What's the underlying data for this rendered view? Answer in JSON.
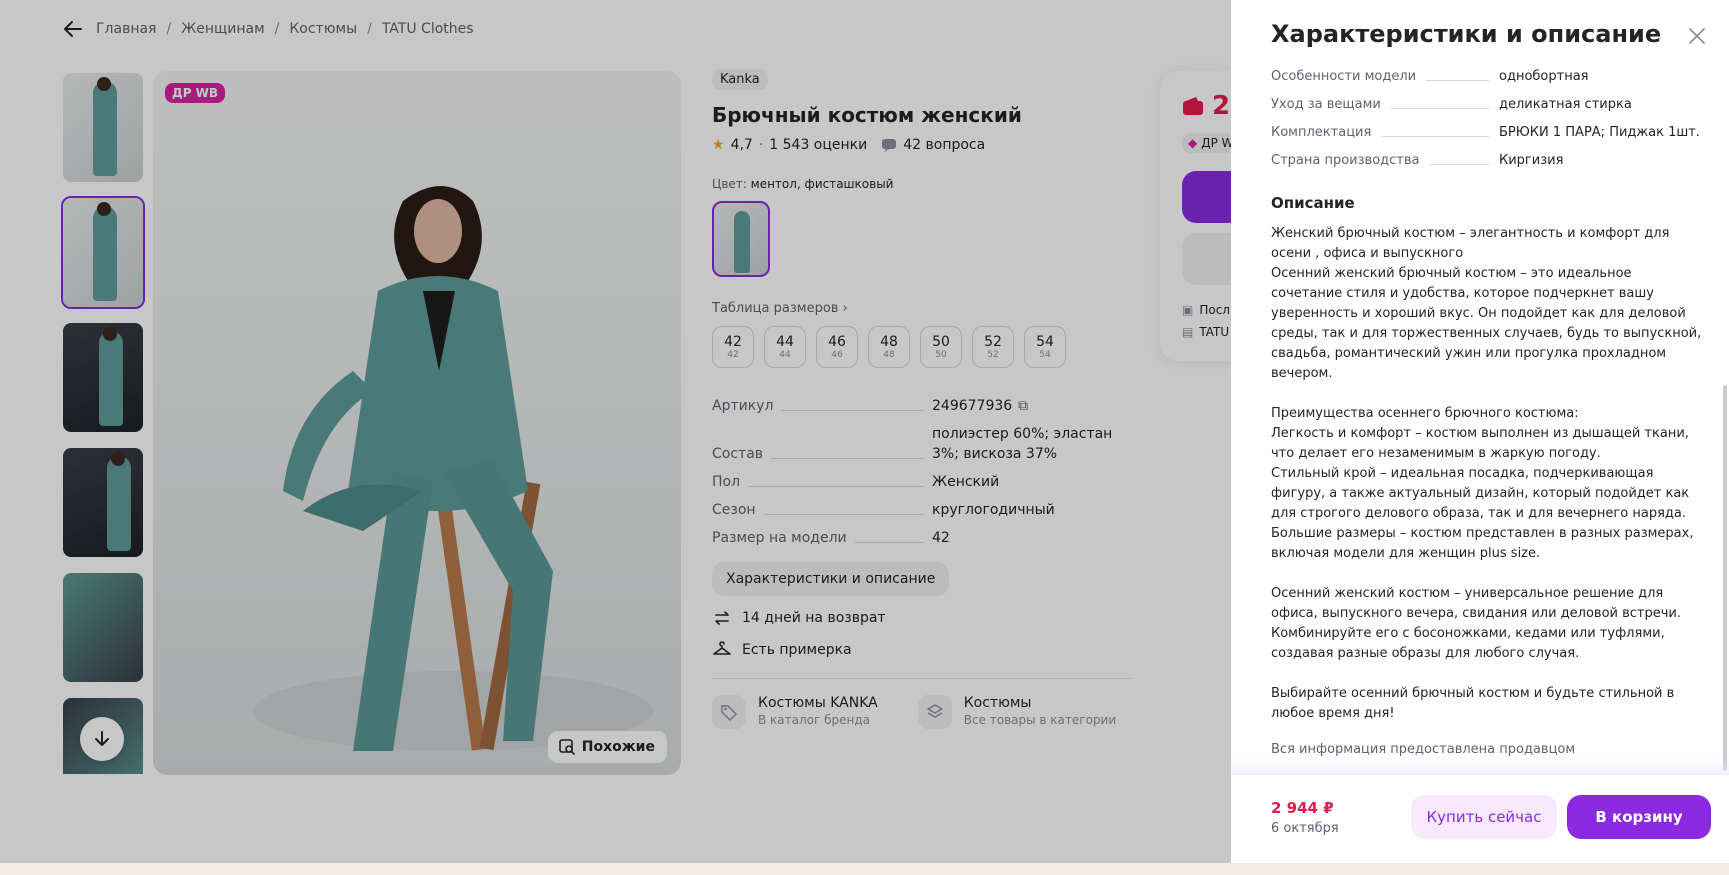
{
  "breadcrumbs": [
    "Главная",
    "Женщинам",
    "Костюмы",
    "TATU Clothes"
  ],
  "gallery": {
    "badge": "ДР WB",
    "similar_label": "Похожие",
    "thumbs": [
      {
        "kind": "photo",
        "active": false
      },
      {
        "kind": "photo",
        "active": true
      },
      {
        "kind": "promo",
        "active": false
      },
      {
        "kind": "promo",
        "active": false
      },
      {
        "kind": "detail",
        "active": false
      },
      {
        "kind": "detail",
        "active": false
      }
    ]
  },
  "product": {
    "brand": "Kanka",
    "title": "Брючный костюм женский",
    "rating": "4,7",
    "rating_count": "1 543 оценки",
    "questions": "42 вопроса",
    "color_label": "Цвет:",
    "color_value": "ментол, фисташковый",
    "size_table_link": "Таблица размеров",
    "sizes": [
      {
        "size": "42",
        "ru": "42"
      },
      {
        "size": "44",
        "ru": "44"
      },
      {
        "size": "46",
        "ru": "46"
      },
      {
        "size": "48",
        "ru": "48"
      },
      {
        "size": "50",
        "ru": "50"
      },
      {
        "size": "52",
        "ru": "52"
      },
      {
        "size": "54",
        "ru": "54"
      }
    ],
    "params": [
      {
        "k": "Артикул",
        "v": "249677936"
      },
      {
        "k": "Состав",
        "v": "полиэстер 60%; эластан 3%; вискоза 37%"
      },
      {
        "k": "Пол",
        "v": "Женский"
      },
      {
        "k": "Сезон",
        "v": "круглогодичный"
      },
      {
        "k": "Размер на модели",
        "v": "42"
      }
    ],
    "char_button": "Характеристики и описание",
    "perks": [
      "14 дней на возврат",
      "Есть примерка"
    ],
    "categories": [
      {
        "title": "Костюмы KANKA",
        "sub": "В каталог бренда"
      },
      {
        "title": "Костюмы",
        "sub": "Все товары в категории"
      }
    ]
  },
  "buy_card": {
    "price_partial": "2",
    "dr_partial": "ДР W",
    "line1": "Посл",
    "line2": "TATU"
  },
  "drawer": {
    "title": "Характеристики и описание",
    "specs": [
      {
        "k": "Особенности модели",
        "v": "однобортная"
      },
      {
        "k": "Уход за вещами",
        "v": "деликатная стирка"
      },
      {
        "k": "Комплектация",
        "v": "БРЮКИ 1 ПАРА; Пиджак 1шт."
      },
      {
        "k": "Страна производства",
        "v": "Киргизия"
      }
    ],
    "description_heading": "Описание",
    "description": "Женский брючный костюм – элегантность и комфорт для осени , офиса и выпускного\nОсенний женский брючный костюм – это идеальное сочетание стиля и удобства, которое подчеркнет вашу уверенность и хороший вкус. Он подойдет как для деловой среды, так и для торжественных случаев, будь то выпускной, свадьба, романтический ужин или прогулка прохладном вечером.\n\nПреимущества осеннего брючного костюма:\nЛегкость и комфорт – костюм выполнен из дышащей ткани, что делает его незаменимым в жаркую погоду.\nСтильный крой – идеальная посадка, подчеркивающая фигуру, а также актуальный дизайн, который подойдет как для строгого делового образа, так и для вечернего наряда.\nБольшие размеры – костюм представлен в разных размерах, включая модели для женщин plus size.\n\nОсенний женский костюм – универсальное решение для офиса, выпускного вечера, свидания или деловой встречи. Комбинируйте его с босоножками, кедами или туфлями, создавая разные образы для любого случая.\n\nВыбирайте осенний брючный костюм и будьте стильной в любое время дня!",
    "seller_note": "Вся информация предоставлена продавцом",
    "footer": {
      "price": "2 944 ₽",
      "delivery": "6 октября",
      "buy_now": "Купить сейчас",
      "to_cart": "В корзину"
    }
  },
  "colors": {
    "accent": "#8a2be2",
    "price": "#e51a4c",
    "badge": "#d6249f",
    "suit": "#5e9d99"
  }
}
